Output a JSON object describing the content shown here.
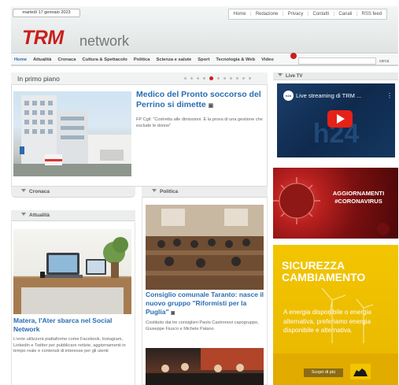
{
  "header": {
    "date": "martedì 17 gennaio 2023",
    "top_links": [
      "Home",
      "Redazione",
      "Privacy",
      "Contatti",
      "Canali",
      "RSS feed"
    ],
    "logo_main": "TRM",
    "logo_sub": "network"
  },
  "nav": {
    "items": [
      "Home",
      "Attualità",
      "Cronaca",
      "Cultura & Spettacolo",
      "Politica",
      "Scienza e salute",
      "Sport",
      "Tecnologia & Web",
      "Video"
    ],
    "active": "Home",
    "video_badge": "",
    "search_button": "cerca"
  },
  "primo_piano": {
    "title": "In primo piano",
    "headline": "Medico del Pronto soccorso del Perrino si dimette",
    "text": "FP Cgil: \"Costretta alle dimissioni. È la prova di una gestione che esclude le donne\"",
    "dots_count": 11,
    "active_dot": 4
  },
  "sections": {
    "cronaca": "Cronaca",
    "attualita": "Attualità",
    "politica": "Politica"
  },
  "attualita_article": {
    "headline": "Matera, l'Ater sbarca nel Social Network",
    "text": "L'ente utilizzerà piattaforme come Facebook, Instagram, Linkedin e Twitter per pubblicare notizie, aggiornamenti in tempo reale e contenuti di interesse per gli utenti"
  },
  "politica_article": {
    "headline": "Consiglio comunale Taranto: nasce il nuovo gruppo \"Riformisti per la Puglia\"",
    "text": "Costituito dai tre consiglieri Paolo Castronovi capogruppo, Giuseppe Fiusco e Michele Patano"
  },
  "live_tv": {
    "header": "Live TV",
    "video_title": "Live streaming di TRM ...",
    "channel_logo": "h24"
  },
  "ads": {
    "covid": "AGGIORNAMENTI #CORONAVIRUS",
    "eni_title_1": "SICUREZZA",
    "eni_title_2": "CAMBIAMENTO",
    "eni_text": "A energia disponibile o energia alternativa, preferiamo energia disponibile e alternativa.",
    "eni_button": "Scopri di più"
  },
  "colors": {
    "brand_red": "#c8201c",
    "link_blue": "#2a6db2"
  }
}
